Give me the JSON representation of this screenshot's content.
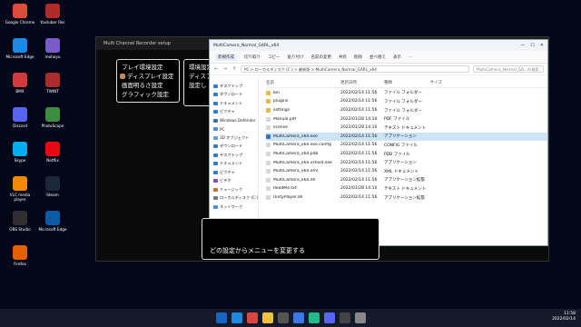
{
  "desktop_icons": [
    {
      "label": "Google Chrome",
      "color": "#dd4b39"
    },
    {
      "label": "Youtuber Rec",
      "color": "#b02a2a"
    },
    {
      "label": "Microsoft Edge",
      "color": "#1e88e5"
    },
    {
      "label": "mohoyu",
      "color": "#7a5cc8"
    },
    {
      "label": "BMX",
      "color": "#d23b3b"
    },
    {
      "label": "TWINT",
      "color": "#aa2b2b"
    },
    {
      "label": "Discord",
      "color": "#5865f2"
    },
    {
      "label": "PhotoScape",
      "color": "#3c8d40"
    },
    {
      "label": "Skype",
      "color": "#00aff0"
    },
    {
      "label": "Netflix",
      "color": "#e50914"
    },
    {
      "label": "VLC media player",
      "color": "#f08a00"
    },
    {
      "label": "Steam",
      "color": "#1b2838"
    },
    {
      "label": "OBS Studio",
      "color": "#302e31"
    },
    {
      "label": "Microsoft Edge",
      "color": "#0c59a4"
    },
    {
      "label": "Firefox",
      "color": "#e66000"
    }
  ],
  "game": {
    "title": "Multi Channel Recorder setup",
    "menu1": [
      "プレイ環境設定",
      "ディスプレイ設定",
      "画面明るさ設定",
      "グラフィック設定"
    ],
    "menu2": [
      "環境設定を",
      "ディスプレ",
      "設定し"
    ],
    "dialog": "どの設定からメニューを変更する"
  },
  "explorer": {
    "title": "MultiCamera_Normal_GARL_x64",
    "toolbar": [
      "新規作成",
      "切り取り",
      "コピー",
      "貼り付け",
      "名前の変更",
      "共有",
      "削除",
      "並べ替え",
      "表示",
      "..."
    ],
    "address": "PC > ローカルディスク (C:) > 最新版 > MultiCamera_Normal_GARL_x64",
    "search_placeholder": "MultiCamera_Normal_GA...の検索",
    "columns": [
      "名前",
      "更新日時",
      "種類",
      "サイズ"
    ],
    "nav": [
      {
        "label": "デスクトップ",
        "color": "#2f7fd0"
      },
      {
        "label": "ダウンロード",
        "color": "#2f7fd0"
      },
      {
        "label": "ドキュメント",
        "color": "#2f7fd0"
      },
      {
        "label": "ピクチャ",
        "color": "#2f7fd0"
      },
      {
        "label": "Windows Defender",
        "color": "#3a6ea5"
      },
      {
        "label": "PC",
        "color": "#4a90d9"
      },
      {
        "label": "3D オブジェクト",
        "color": "#6b9bd2"
      },
      {
        "label": "ダウンロード",
        "color": "#2f7fd0"
      },
      {
        "label": "デスクトップ",
        "color": "#2f7fd0"
      },
      {
        "label": "ドキュメント",
        "color": "#2f7fd0"
      },
      {
        "label": "ピクチャ",
        "color": "#2f7fd0"
      },
      {
        "label": "ビデオ",
        "color": "#7d4bc4"
      },
      {
        "label": "ミュージック",
        "color": "#d26a2a"
      },
      {
        "label": "ローカルディスク (C:)",
        "color": "#777777"
      },
      {
        "label": "ネットワーク",
        "color": "#4a90d9"
      }
    ],
    "files": [
      {
        "name": "bin",
        "date": "2022/02/14 11:56",
        "type": "ファイル フォルダー",
        "size": "",
        "kind": "folder"
      },
      {
        "name": "plugins",
        "date": "2022/02/14 11:56",
        "type": "ファイル フォルダー",
        "size": "",
        "kind": "folder"
      },
      {
        "name": "settings",
        "date": "2022/02/14 11:56",
        "type": "ファイル フォルダー",
        "size": "",
        "kind": "folder"
      },
      {
        "name": "Manual.pdf",
        "date": "2022/01/28 14:10",
        "type": "PDF ファイル",
        "size": "",
        "kind": "file"
      },
      {
        "name": "license",
        "date": "2022/01/28 14:10",
        "type": "テキスト ドキュメント",
        "size": "",
        "kind": "file"
      },
      {
        "name": "MultiCamera_x64.exe",
        "date": "2022/02/14 11:56",
        "type": "アプリケーション",
        "size": "",
        "kind": "exe"
      },
      {
        "name": "MultiCamera_x64.exe.config",
        "date": "2022/02/14 11:56",
        "type": "CONFIG ファイル",
        "size": "",
        "kind": "file"
      },
      {
        "name": "MultiCamera_x64.pdb",
        "date": "2022/02/14 11:56",
        "type": "PDB ファイル",
        "size": "",
        "kind": "file"
      },
      {
        "name": "MultiCamera_x64.vshost.exe",
        "date": "2022/02/14 11:56",
        "type": "アプリケーション",
        "size": "",
        "kind": "file"
      },
      {
        "name": "MultiCamera_x64.xml",
        "date": "2022/02/14 11:56",
        "type": "XML ドキュメント",
        "size": "",
        "kind": "file"
      },
      {
        "name": "MultiCamera_x64.dll",
        "date": "2022/02/14 11:56",
        "type": "アプリケーション拡張",
        "size": "",
        "kind": "file"
      },
      {
        "name": "ReadMe.txt",
        "date": "2022/01/28 14:10",
        "type": "テキスト ドキュメント",
        "size": "",
        "kind": "file"
      },
      {
        "name": "UnityPlayer.dll",
        "date": "2022/02/14 11:56",
        "type": "アプリケーション拡張",
        "size": "",
        "kind": "file"
      }
    ]
  },
  "taskbar": {
    "apps": [
      "#1e88e5",
      "#d44",
      "#f0c040",
      "#555",
      "#3b78e7",
      "#2b8",
      "#5865f2",
      "#444",
      "#888"
    ],
    "time": "11:58",
    "date": "2022/02/14"
  }
}
